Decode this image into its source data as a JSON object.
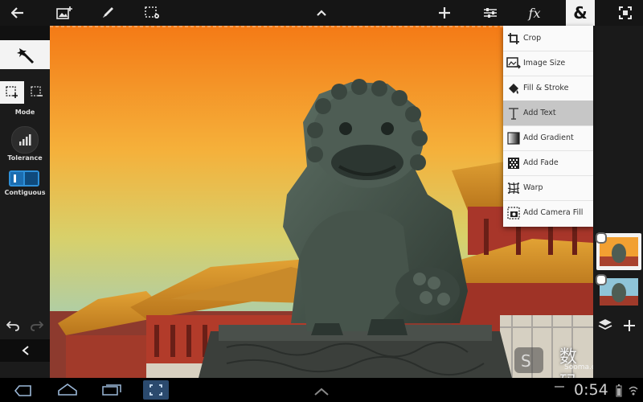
{
  "menu": {
    "items": [
      {
        "label": "Crop",
        "icon": "crop-icon"
      },
      {
        "label": "Image Size",
        "icon": "image-size-icon"
      },
      {
        "label": "Fill & Stroke",
        "icon": "fill-stroke-icon"
      },
      {
        "label": "Add Text",
        "icon": "text-icon"
      },
      {
        "label": "Add Gradient",
        "icon": "gradient-icon"
      },
      {
        "label": "Add Fade",
        "icon": "fade-icon"
      },
      {
        "label": "Warp",
        "icon": "warp-icon"
      },
      {
        "label": "Add Camera Fill",
        "icon": "camera-fill-icon"
      }
    ],
    "selected": "Add Text"
  },
  "toolbar": {
    "fx_label": "fx",
    "ampersand_label": "&"
  },
  "left_panel": {
    "mode_label": "Mode",
    "tolerance_label": "Tolerance",
    "contiguous_label": "Contiguous"
  },
  "watermark": {
    "cn_text": "数码多",
    "site_text": "Sooma.com"
  },
  "status": {
    "clock": "0:54"
  },
  "colors": {
    "toolbar_bg": "#151515",
    "panel_bg": "#1b1b1b",
    "menu_bg": "#fafafa",
    "menu_selected": "#c6c6c6",
    "sky_top": "#f57a16",
    "sky_bottom": "#8ecbd6",
    "contiguous_blue": "#2d8fd8"
  }
}
